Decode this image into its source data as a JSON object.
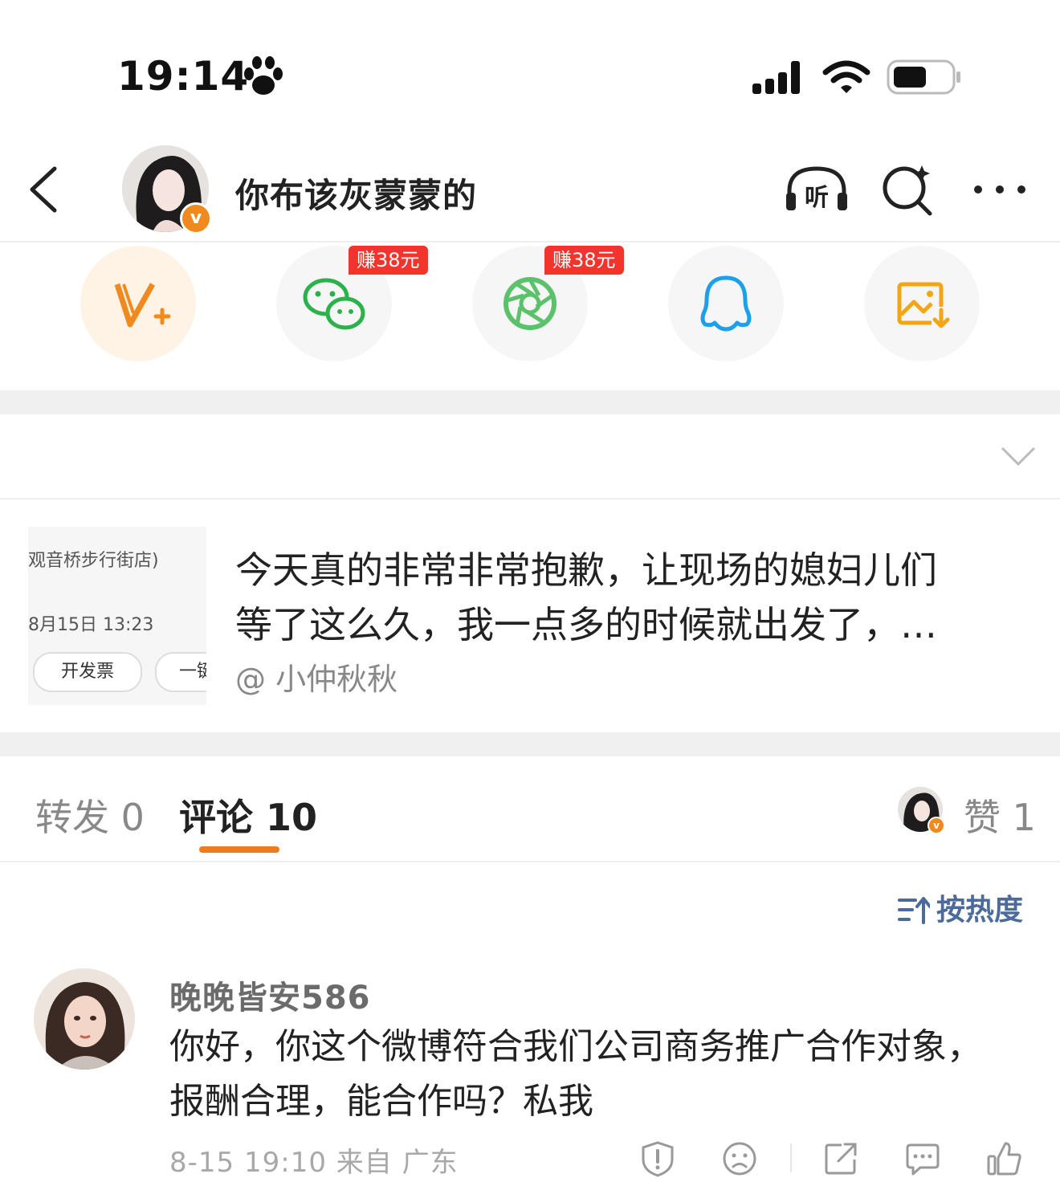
{
  "status_bar": {
    "time": "19:14"
  },
  "header": {
    "nickname": "你布该灰蒙蒙的"
  },
  "share": {
    "wechat_badge": "赚38元",
    "moments_badge": "赚38元"
  },
  "quoted_post": {
    "thumbnail": {
      "store_text": "观音桥步行街店)",
      "date_text": "8月15日 13:23",
      "btn1": "开发票",
      "btn2": "一键"
    },
    "text_line1": "今天真的非常非常抱歉，让现场的媳妇儿们",
    "text_line2": "等了这么久，我一点多的时候就出发了，…",
    "author": "@ 小仲秋秋"
  },
  "tabs": {
    "repost": "转发 0",
    "comment": "评论 10",
    "likes": "赞 1"
  },
  "sort_label": "按热度",
  "comment": {
    "name": "晚晚皆安586",
    "line1": "你好，你这个微博符合我们公司商务推广合作对象，",
    "line2": "报酬合理，能合作吗？私我",
    "meta": "8-15 19:10  来自 广东"
  },
  "colors": {
    "accent_orange": "#f07b1a",
    "earn_red": "#f2342c",
    "wechat_green": "#2bb24c",
    "moments_green": "#5cc16b",
    "qq_blue": "#1ea0e8",
    "sort_blue": "#4c6a9a"
  },
  "icons": {
    "status": [
      "paw-icon",
      "signal-icon",
      "wifi-icon",
      "battery-icon"
    ],
    "header": [
      "back-icon",
      "listen-icon",
      "search-icon",
      "more-icon"
    ],
    "share": [
      "vplus-icon",
      "wechat-icon",
      "moments-icon",
      "qq-icon",
      "save-image-icon"
    ],
    "comment_actions": [
      "report-icon",
      "dislike-icon",
      "share-icon",
      "comment-icon",
      "like-icon"
    ]
  }
}
